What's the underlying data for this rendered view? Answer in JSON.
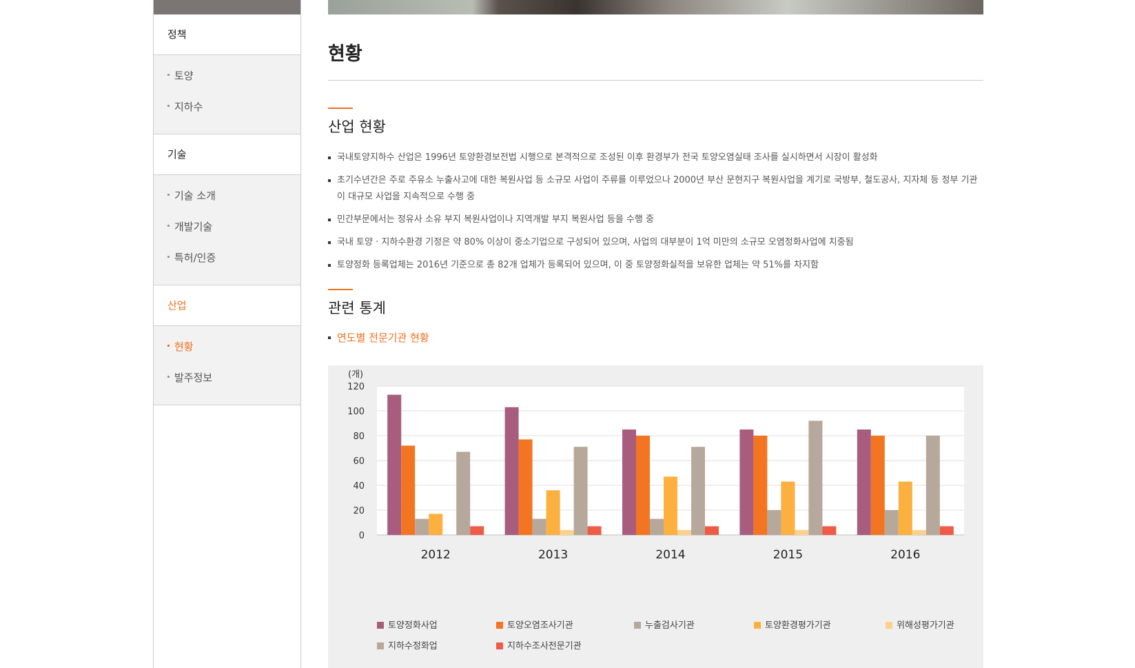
{
  "sidebar": {
    "categories": [
      {
        "label": "정책",
        "items": [
          {
            "label": "토양"
          },
          {
            "label": "지하수"
          }
        ]
      },
      {
        "label": "기술",
        "items": [
          {
            "label": "기술 소개"
          },
          {
            "label": "개발기술"
          },
          {
            "label": "특허/인증"
          }
        ]
      },
      {
        "label": "산업",
        "items": [
          {
            "label": "현황"
          },
          {
            "label": "발주정보"
          }
        ]
      }
    ],
    "active_category": "산업",
    "active_item": "현황"
  },
  "page": {
    "title": "현황",
    "industry_section": {
      "heading": "산업 현황",
      "bullets": [
        "국내토양지하수 산업은 1996년 토양환경보전법 시행으로 본격적으로 조성된 이후 환경부가 전국 토양오염실태 조사를 실시하면서 시장이 활성화",
        "초기수년간은 주로 주유소 누출사고에 대한 복원사업 등 소규모 사업이 주류를 이루었으나 2000년 부산 문현지구 복원사업을 계기로 국방부, 철도공사, 지자체 등 정부 기관이 대규모 사업을 지속적으로 수행 중",
        "민간부문에서는 정유사 소유 부지 복원사업이나 지역개발 부지 복원사업 등을 수행 중",
        "국내 토양 · 지하수환경 기정은 약 80% 이상이 중소기업으로 구성되어 있으며, 사업의 대부분이 1억 미만의 소규모 오염정화사업에 치중됨",
        "토양정화 등록업체는 2016년 기준으로 총 82개 업체가 등록되어 있으며, 이 중 토양정화실적을 보유한 업체는 약 51%를 차지함"
      ]
    },
    "stats_section": {
      "heading": "관련 통계",
      "subheading": "연도별 전문기관 현황"
    }
  },
  "chart_data": {
    "type": "bar",
    "unit_label": "(개)",
    "categories": [
      "2012",
      "2013",
      "2014",
      "2015",
      "2016"
    ],
    "ylim": [
      0,
      120
    ],
    "yticks": [
      0,
      20,
      40,
      60,
      80,
      100,
      120
    ],
    "grid": true,
    "legend_position": "bottom",
    "series": [
      {
        "name": "토양정화사업",
        "color": "#a85c7e",
        "values": [
          113,
          103,
          85,
          85,
          85
        ]
      },
      {
        "name": "토양오염조사기관",
        "color": "#f37521",
        "values": [
          72,
          77,
          80,
          80,
          80
        ]
      },
      {
        "name": "누출검사기관",
        "color": "#b6a89a",
        "values": [
          13,
          13,
          13,
          20,
          20
        ]
      },
      {
        "name": "토양환경평가기관",
        "color": "#fbb040",
        "values": [
          17,
          36,
          47,
          43,
          43
        ]
      },
      {
        "name": "위해성평가기관",
        "color": "#fdd08c",
        "values": [
          0,
          4,
          4,
          4,
          4
        ]
      },
      {
        "name": "지하수정화업",
        "color": "#b6a89a",
        "values": [
          67,
          71,
          71,
          92,
          80
        ]
      },
      {
        "name": "지하수조사전문기관",
        "color": "#ef5a47",
        "values": [
          7,
          7,
          7,
          7,
          7
        ]
      }
    ]
  }
}
